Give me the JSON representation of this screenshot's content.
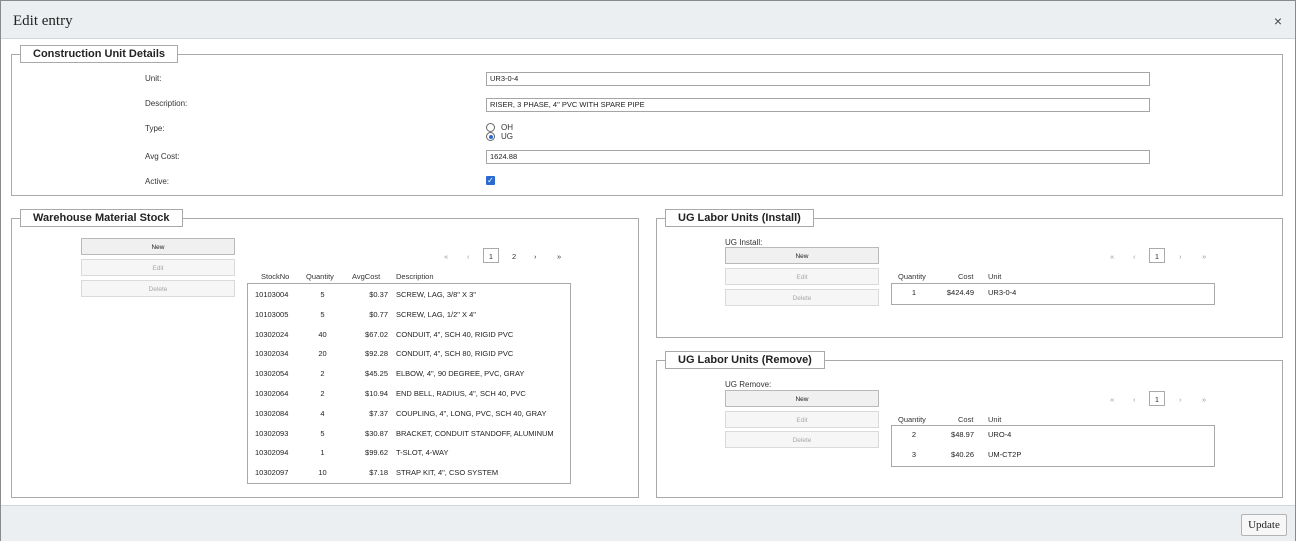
{
  "dialog": {
    "title": "Edit entry",
    "close_label": "×",
    "update_label": "Update"
  },
  "details": {
    "legend": "Construction Unit Details",
    "unit_label": "Unit:",
    "unit_value": "UR3-0-4",
    "description_label": "Description:",
    "description_value": "RISER, 3 PHASE, 4\" PVC WITH SPARE PIPE",
    "type_label": "Type:",
    "type_options": [
      "OH",
      "UG"
    ],
    "type_selected": "UG",
    "avg_cost_label": "Avg Cost:",
    "avg_cost_value": "1624.88",
    "active_label": "Active:",
    "active_checked": true
  },
  "warehouse": {
    "legend": "Warehouse Material Stock",
    "buttons": {
      "new": "New",
      "edit": "Edit",
      "delete": "Delete"
    },
    "pager": {
      "first": "«",
      "prev": "‹",
      "current": "1",
      "page2": "2",
      "next": "›",
      "last": "»"
    },
    "columns": [
      "StockNo",
      "Quantity",
      "AvgCost",
      "Description"
    ],
    "rows": [
      {
        "stock": "10103004",
        "qty": "5",
        "cost": "$0.37",
        "desc": "SCREW, LAG, 3/8\" X 3\""
      },
      {
        "stock": "10103005",
        "qty": "5",
        "cost": "$0.77",
        "desc": "SCREW, LAG, 1/2\" X 4\""
      },
      {
        "stock": "10302024",
        "qty": "40",
        "cost": "$67.02",
        "desc": "CONDUIT, 4\", SCH 40, RIGID PVC"
      },
      {
        "stock": "10302034",
        "qty": "20",
        "cost": "$92.28",
        "desc": "CONDUIT, 4\", SCH 80, RIGID PVC"
      },
      {
        "stock": "10302054",
        "qty": "2",
        "cost": "$45.25",
        "desc": "ELBOW, 4\", 90 DEGREE, PVC, GRAY"
      },
      {
        "stock": "10302064",
        "qty": "2",
        "cost": "$10.94",
        "desc": "END BELL, RADIUS, 4\", SCH 40, PVC"
      },
      {
        "stock": "10302084",
        "qty": "4",
        "cost": "$7.37",
        "desc": "COUPLING, 4\", LONG, PVC, SCH 40, GRAY"
      },
      {
        "stock": "10302093",
        "qty": "5",
        "cost": "$30.87",
        "desc": "BRACKET, CONDUIT STANDOFF, ALUMINUM"
      },
      {
        "stock": "10302094",
        "qty": "1",
        "cost": "$99.62",
        "desc": "T-SLOT, 4-WAY"
      },
      {
        "stock": "10302097",
        "qty": "10",
        "cost": "$7.18",
        "desc": "STRAP KIT, 4\", CSO SYSTEM"
      }
    ]
  },
  "install": {
    "legend": "UG Labor Units (Install)",
    "sublabel": "UG Install:",
    "buttons": {
      "new": "New",
      "edit": "Edit",
      "delete": "Delete"
    },
    "pager": {
      "first": "«",
      "prev": "‹",
      "current": "1",
      "next": "›",
      "last": "»"
    },
    "columns": [
      "Quantity",
      "Cost",
      "Unit"
    ],
    "rows": [
      {
        "qty": "1",
        "cost": "$424.49",
        "unit": "UR3-0-4"
      }
    ]
  },
  "remove": {
    "legend": "UG Labor Units (Remove)",
    "sublabel": "UG Remove:",
    "buttons": {
      "new": "New",
      "edit": "Edit",
      "delete": "Delete"
    },
    "pager": {
      "first": "«",
      "prev": "‹",
      "current": "1",
      "next": "›",
      "last": "»"
    },
    "columns": [
      "Quantity",
      "Cost",
      "Unit"
    ],
    "rows": [
      {
        "qty": "2",
        "cost": "$48.97",
        "unit": "URO-4"
      },
      {
        "qty": "3",
        "cost": "$40.26",
        "unit": "UM-CT2P"
      }
    ]
  }
}
